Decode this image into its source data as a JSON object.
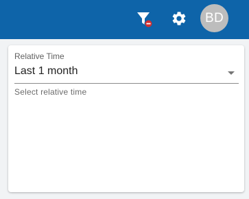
{
  "header": {
    "filter_icon": "filter-remove-icon",
    "settings_icon": "gear-icon",
    "avatar_initials": "BD",
    "background_color": "#0e64a9"
  },
  "relative_time": {
    "label": "Relative Time",
    "selected_value": "Last 1 month",
    "helper_text": "Select relative time"
  }
}
